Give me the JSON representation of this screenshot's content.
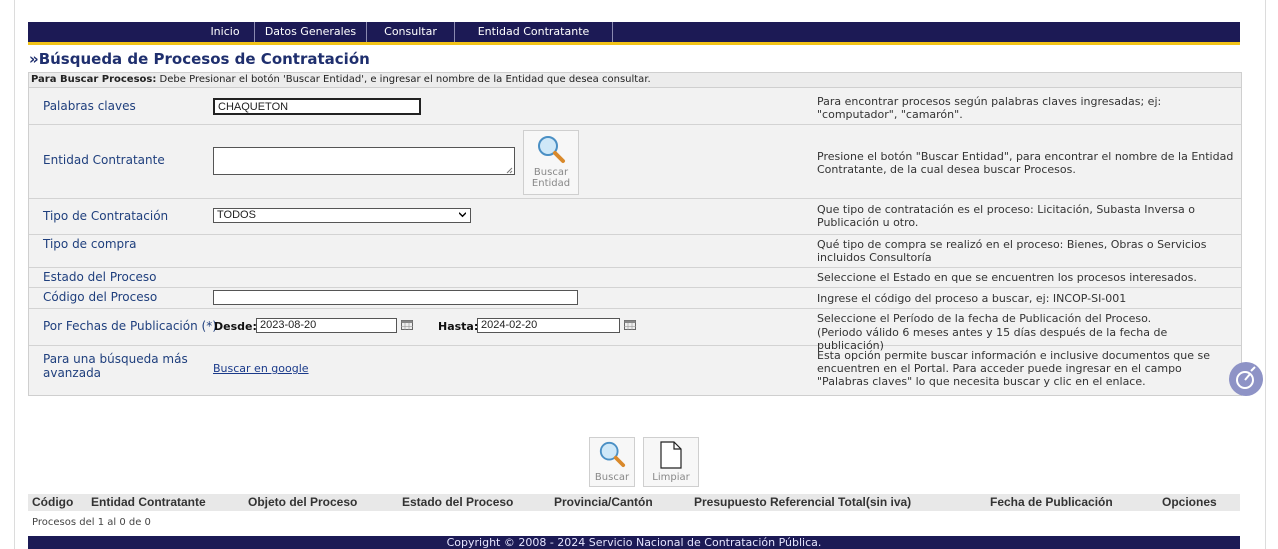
{
  "nav": {
    "items": [
      "Inicio",
      "Datos Generales",
      "Consultar",
      "Entidad Contratante"
    ]
  },
  "page": {
    "title": "»Búsqueda de Procesos de Contratación",
    "instr_bold": "Para Buscar Procesos:",
    "instr_text": " Debe Presionar el botón 'Buscar Entidad', e ingresar el nombre de la Entidad que desea consultar."
  },
  "form": {
    "keywords": {
      "label": "Palabras claves",
      "value": "CHAQUETON",
      "help": "Para encontrar procesos según palabras claves ingresadas; ej: \"computador\", \"camarón\"."
    },
    "entity": {
      "label": "Entidad Contratante",
      "value": "",
      "button_line1": "Buscar",
      "button_line2": "Entidad",
      "help": "Presione el botón \"Buscar Entidad\", para encontrar el nombre de la Entidad Contratante, de la cual desea buscar Procesos."
    },
    "contract_type": {
      "label": "Tipo de Contratación",
      "selected": "TODOS",
      "help": "Que tipo de contratación es el proceso: Licitación, Subasta Inversa o Publicación u otro."
    },
    "purchase_type": {
      "label": "Tipo de compra",
      "help": "Qué tipo de compra se realizó en el proceso: Bienes, Obras o Servicios incluidos Consultoría"
    },
    "state": {
      "label": "Estado del Proceso",
      "help": "Seleccione el Estado en que se encuentren los procesos interesados."
    },
    "code": {
      "label": "Código del Proceso",
      "value": "",
      "help": "Ingrese el código del proceso a buscar, ej: INCOP-SI-001"
    },
    "dates": {
      "label": "Por Fechas de Publicación (*)",
      "from_label": "Desde:",
      "from_value": "2023-08-20",
      "to_label": "Hasta:",
      "to_value": "2024-02-20",
      "help1": "Seleccione el Período de la fecha de Publicación del Proceso.",
      "help2": "(Periodo válido 6 meses antes y 15 días después de la fecha de publicación)"
    },
    "advanced": {
      "label": "Para una búsqueda más avanzada",
      "link": "Buscar en google",
      "help": "Esta opción permite buscar información e inclusive documentos que se encuentren en el Portal. Para acceder puede ingresar en el campo \"Palabras claves\" lo que necesita buscar y clic en el enlace."
    }
  },
  "actions": {
    "search": "Buscar",
    "clear": "Limpiar"
  },
  "table": {
    "columns": [
      "Código",
      "Entidad Contratante",
      "Objeto del Proceso",
      "Estado del Proceso",
      "Provincia/Cantón",
      "Presupuesto Referencial Total(sin iva)",
      "Fecha de Publicación",
      "Opciones"
    ],
    "count_text": "Procesos del 1 al 0 de 0"
  },
  "footer": {
    "text": "Copyright © 2008 - 2024 Servicio Nacional de Contratación Pública."
  },
  "colors": {
    "nav_bg": "#1c1a55",
    "accent": "#f2c318",
    "title": "#1f2f6e",
    "label": "#1f3f7d"
  }
}
